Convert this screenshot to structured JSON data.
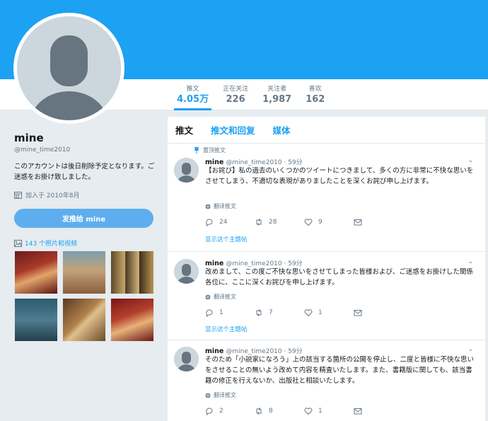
{
  "profile": {
    "name": "mine",
    "handle": "@mine_time2010",
    "bio": "このアカウントは後日削除予定となります。ご迷惑をお掛け致しました。",
    "joined": "加入于 2010年8月",
    "dm_button": "发推给 mine",
    "media_link": "143 个照片和视频"
  },
  "stats": [
    {
      "label": "推文",
      "value": "4.05万"
    },
    {
      "label": "正在关注",
      "value": "226"
    },
    {
      "label": "关注者",
      "value": "1,987"
    },
    {
      "label": "喜欢",
      "value": "162"
    }
  ],
  "tabs": [
    "推文",
    "推文和回复",
    "媒体"
  ],
  "tweets": [
    {
      "pinned_label": "置顶推文",
      "name": "mine",
      "handle_time": "@mine_time2010 · 59分",
      "text": "【お詫び】私の過去のいくつかのツイートにつきまして、多くの方に非常に不快な思いをさせてしまう、不適切な表現がありましたことを深くお詫び申し上げます。",
      "translate": "翻译推文",
      "replies": "24",
      "retweets": "28",
      "likes": "9",
      "thread_link": "显示这个主题帖"
    },
    {
      "name": "mine",
      "handle_time": "@mine_time2010 · 59分",
      "text": "改めまして、この度ご不快な思いをさせてしまった皆様および、ご迷惑をお掛けした関係各位に、ここに深くお詫びを申し上げます。",
      "translate": "翻译推文",
      "replies": "1",
      "retweets": "7",
      "likes": "1",
      "thread_link": "显示这个主题帖"
    },
    {
      "name": "mine",
      "handle_time": "@mine_time2010 · 59分",
      "text": "そのため「小説家になろう」上の該当する箇所の公開を停止し、二度と皆様に不快な思いをさせることの無いよう改めて内容を精査いたします。また、書籍版に関しても、該当書籍の修正を行えないか、出版社と相談いたします。",
      "translate": "翻译推文",
      "replies": "2",
      "retweets": "8",
      "likes": "1"
    }
  ],
  "colors": {
    "accent": "#1da1f2",
    "background": "#e6ecf0",
    "button": "#5eaeef"
  },
  "icons": [
    "pin-icon",
    "calendar-icon",
    "image-icon",
    "globe-icon",
    "reply-icon",
    "retweet-icon",
    "like-icon",
    "dm-icon",
    "chevron-down-icon"
  ]
}
